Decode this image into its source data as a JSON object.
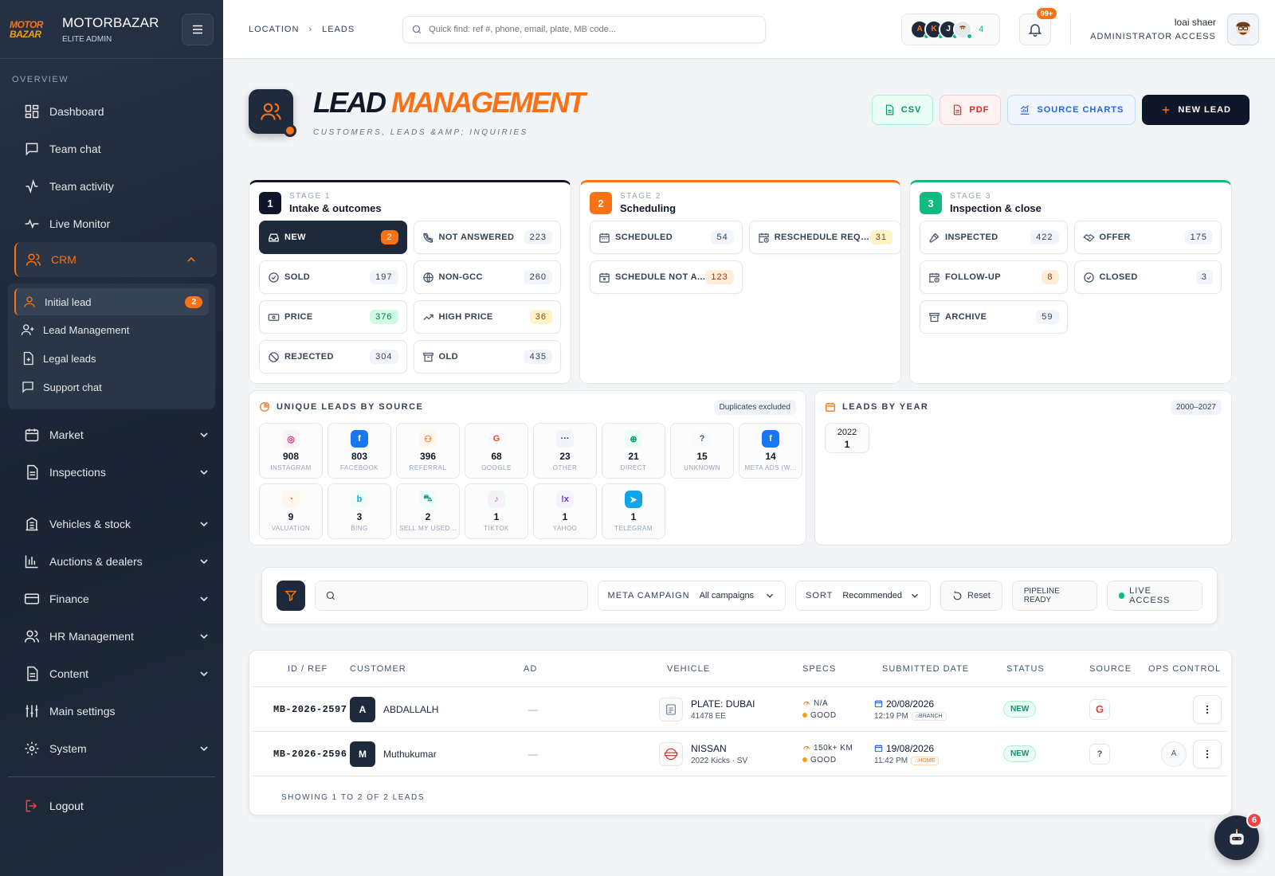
{
  "brand": {
    "logo_line1": "MOTOR",
    "logo_line2": "BAZAR",
    "name": "MOTORBAZAR",
    "subtitle": "ELITE ADMIN"
  },
  "sidebar": {
    "section_label": "OVERVIEW",
    "top_items": [
      {
        "label": "Dashboard",
        "icon": "dashboard-icon"
      },
      {
        "label": "Team chat",
        "icon": "chat-icon"
      },
      {
        "label": "Team activity",
        "icon": "activity-icon"
      },
      {
        "label": "Live Monitor",
        "icon": "pulse-icon"
      }
    ],
    "crm": {
      "label": "CRM",
      "icon": "users-icon"
    },
    "crm_sub": [
      {
        "label": "Initial lead",
        "badge": "2",
        "icon": "user-icon"
      },
      {
        "label": "Lead Management",
        "icon": "user-plus-icon"
      },
      {
        "label": "Legal leads",
        "icon": "file-plus-icon"
      },
      {
        "label": "Support chat",
        "icon": "chat-icon"
      }
    ],
    "groups": [
      {
        "label": "Market",
        "icon": "calendar-icon"
      },
      {
        "label": "Inspections",
        "icon": "document-icon"
      },
      {
        "label": "Vehicles & stock",
        "icon": "building-icon"
      },
      {
        "label": "Auctions & dealers",
        "icon": "bar-chart-icon"
      },
      {
        "label": "Finance",
        "icon": "card-icon"
      },
      {
        "label": "HR Management",
        "icon": "users-icon"
      },
      {
        "label": "Content",
        "icon": "document-icon"
      },
      {
        "label": "Main settings",
        "icon": "sliders-icon"
      },
      {
        "label": "System",
        "icon": "gear-icon"
      }
    ],
    "logout": "Logout"
  },
  "topbar": {
    "breadcrumb": [
      "LOCATION",
      "LEADS"
    ],
    "search_placeholder": "Quick find: ref #, phone, email, plate, MB code...",
    "avatars": [
      "A",
      "K",
      "J"
    ],
    "online_count": "4",
    "notifications": "99+",
    "user_name": "loai shaer",
    "user_role": "ADMINISTRATOR ACCESS"
  },
  "header": {
    "title_a": "LEAD",
    "title_b": "MANAGEMENT",
    "subtitle": "CUSTOMERS, LEADS &AMP; INQUIRIES"
  },
  "actions": {
    "csv": "CSV",
    "pdf": "PDF",
    "charts": "SOURCE CHARTS",
    "new_lead": "NEW LEAD"
  },
  "stages": [
    {
      "num": "1",
      "label": "STAGE 1",
      "name": "Intake & outcomes",
      "chips": [
        {
          "label": "NEW",
          "count": "2",
          "icon": "inbox-icon",
          "active": true
        },
        {
          "label": "NOT ANSWERED",
          "count": "223",
          "icon": "phone-off-icon"
        },
        {
          "label": "SOLD",
          "count": "197",
          "icon": "check-circle-icon"
        },
        {
          "label": "NON-GCC",
          "count": "260",
          "icon": "globe-icon"
        },
        {
          "label": "PRICE",
          "count": "376",
          "icon": "banknote-icon",
          "tone": "green"
        },
        {
          "label": "HIGH PRICE",
          "count": "36",
          "icon": "trend-up-icon",
          "tone": "amber"
        },
        {
          "label": "REJECTED",
          "count": "304",
          "icon": "ban-icon"
        },
        {
          "label": "OLD",
          "count": "435",
          "icon": "archive-icon"
        }
      ]
    },
    {
      "num": "2",
      "label": "STAGE 2",
      "name": "Scheduling",
      "chips": [
        {
          "label": "SCHEDULED",
          "count": "54",
          "icon": "calendar-icon"
        },
        {
          "label": "RESCHEDULE REQU...",
          "count": "31",
          "icon": "calendar-clock-icon",
          "tone": "amber"
        },
        {
          "label": "SCHEDULE NOT A...",
          "count": "123",
          "icon": "calendar-x-icon",
          "tone": "orange"
        }
      ]
    },
    {
      "num": "3",
      "label": "STAGE 3",
      "name": "Inspection & close",
      "chips": [
        {
          "label": "INSPECTED",
          "count": "422",
          "icon": "hammer-icon"
        },
        {
          "label": "OFFER",
          "count": "175",
          "icon": "handshake-icon"
        },
        {
          "label": "FOLLOW-UP",
          "count": "8",
          "icon": "calendar-clock-icon",
          "tone": "orange"
        },
        {
          "label": "CLOSED",
          "count": "3",
          "icon": "check-circle-icon"
        },
        {
          "label": "ARCHIVE",
          "count": "59",
          "icon": "archive-icon"
        }
      ]
    }
  ],
  "sources": {
    "title": "UNIQUE LEADS BY SOURCE",
    "tag": "Duplicates excluded",
    "items": [
      {
        "value": "908",
        "name": "INSTAGRAM",
        "icon": "instagram-icon",
        "glyph": "◎",
        "color": "#db2777",
        "bg": "#fdf2f8"
      },
      {
        "value": "803",
        "name": "FACEBOOK",
        "icon": "facebook-icon",
        "glyph": "f",
        "color": "#ffffff",
        "bg": "#1877f2"
      },
      {
        "value": "396",
        "name": "REFERRAL",
        "icon": "users-icon",
        "glyph": "⚇",
        "color": "#f97316",
        "bg": "#fff7ed"
      },
      {
        "value": "68",
        "name": "GOOGLE",
        "icon": "google-icon",
        "glyph": "G",
        "color": "#ea4335",
        "bg": "#f8fafc"
      },
      {
        "value": "23",
        "name": "OTHER",
        "icon": "more-icon",
        "glyph": "···",
        "color": "#334155",
        "bg": "#f1f5f9"
      },
      {
        "value": "21",
        "name": "DIRECT",
        "icon": "globe-icon",
        "glyph": "⊕",
        "color": "#059669",
        "bg": "#ecfdf5"
      },
      {
        "value": "15",
        "name": "UNKNOWN",
        "icon": "question-icon",
        "glyph": "?",
        "color": "#475569",
        "bg": "#f8fafc"
      },
      {
        "value": "14",
        "name": "META ADS (W...",
        "icon": "facebook-icon",
        "glyph": "f",
        "color": "#ffffff",
        "bg": "#1877f2"
      },
      {
        "value": "9",
        "name": "VALUATION",
        "icon": "gauge-icon",
        "glyph": "◔",
        "color": "#f97316",
        "bg": "#fff7ed"
      },
      {
        "value": "3",
        "name": "BING",
        "icon": "bing-icon",
        "glyph": "b",
        "color": "#0ea5e9",
        "bg": "#f0fdfa"
      },
      {
        "value": "2",
        "name": "SELL MY USED...",
        "icon": "car-icon",
        "glyph": "⛍",
        "color": "#0d9488",
        "bg": "#f0fdfa"
      },
      {
        "value": "1",
        "name": "TIKTOK",
        "icon": "tiktok-icon",
        "glyph": "♪",
        "color": "#ec4899",
        "bg": "#f1f5f9"
      },
      {
        "value": "1",
        "name": "YAHOO",
        "icon": "yahoo-icon",
        "glyph": "!x",
        "color": "#6d28d9",
        "bg": "#f5f3ff"
      },
      {
        "value": "1",
        "name": "TELEGRAM",
        "icon": "telegram-icon",
        "glyph": "➤",
        "color": "#ffffff",
        "bg": "#0ea5e9"
      }
    ]
  },
  "years": {
    "title": "LEADS BY YEAR",
    "range": "2000–2027",
    "items": [
      {
        "year": "2022",
        "value": "1"
      }
    ]
  },
  "filters": {
    "campaign_label": "META CAMPAIGN",
    "campaign_value": "All campaigns",
    "sort_label": "SORT",
    "sort_value": "Recommended",
    "reset": "Reset",
    "pipeline": "PIPELINE READY",
    "live": "LIVE ACCESS"
  },
  "table": {
    "columns": [
      "ID / REF",
      "CUSTOMER",
      "AD",
      "VEHICLE",
      "SPECS",
      "SUBMITTED DATE",
      "STATUS",
      "SOURCE",
      "OPS CONTROL"
    ],
    "rows": [
      {
        "ref": "MB-2026-2597",
        "initial": "A",
        "customer": "ABDALLALH",
        "ad": "—",
        "vehicle": "PLATE: DUBAI",
        "vehicle_sub": "41478 EE",
        "vehicle_icon": "document-icon",
        "spec1": "N/A",
        "spec2": "GOOD",
        "date": "20/08/2026",
        "time": "12:19 PM",
        "place": "BRANCH",
        "status": "NEW",
        "source_icon": "google-icon",
        "source_glyph": "G",
        "assignee": ""
      },
      {
        "ref": "MB-2026-2596",
        "initial": "M",
        "customer": "Muthukumar",
        "ad": "—",
        "vehicle": "NISSAN",
        "vehicle_sub": "2022 Kicks · SV",
        "vehicle_icon": "nissan-logo-icon",
        "spec1": "150k+ KM",
        "spec2": "GOOD",
        "date": "19/08/2026",
        "time": "11:42 PM",
        "place": "HOME",
        "status": "NEW",
        "source_icon": "question-icon",
        "source_glyph": "?",
        "assignee": "A"
      }
    ],
    "footer": "SHOWING 1 TO 2 OF 2 LEADS"
  },
  "chatbot": {
    "badge": "6"
  },
  "colors": {
    "accent": "#f97316",
    "navy": "#1e293b",
    "success": "#10b981"
  }
}
